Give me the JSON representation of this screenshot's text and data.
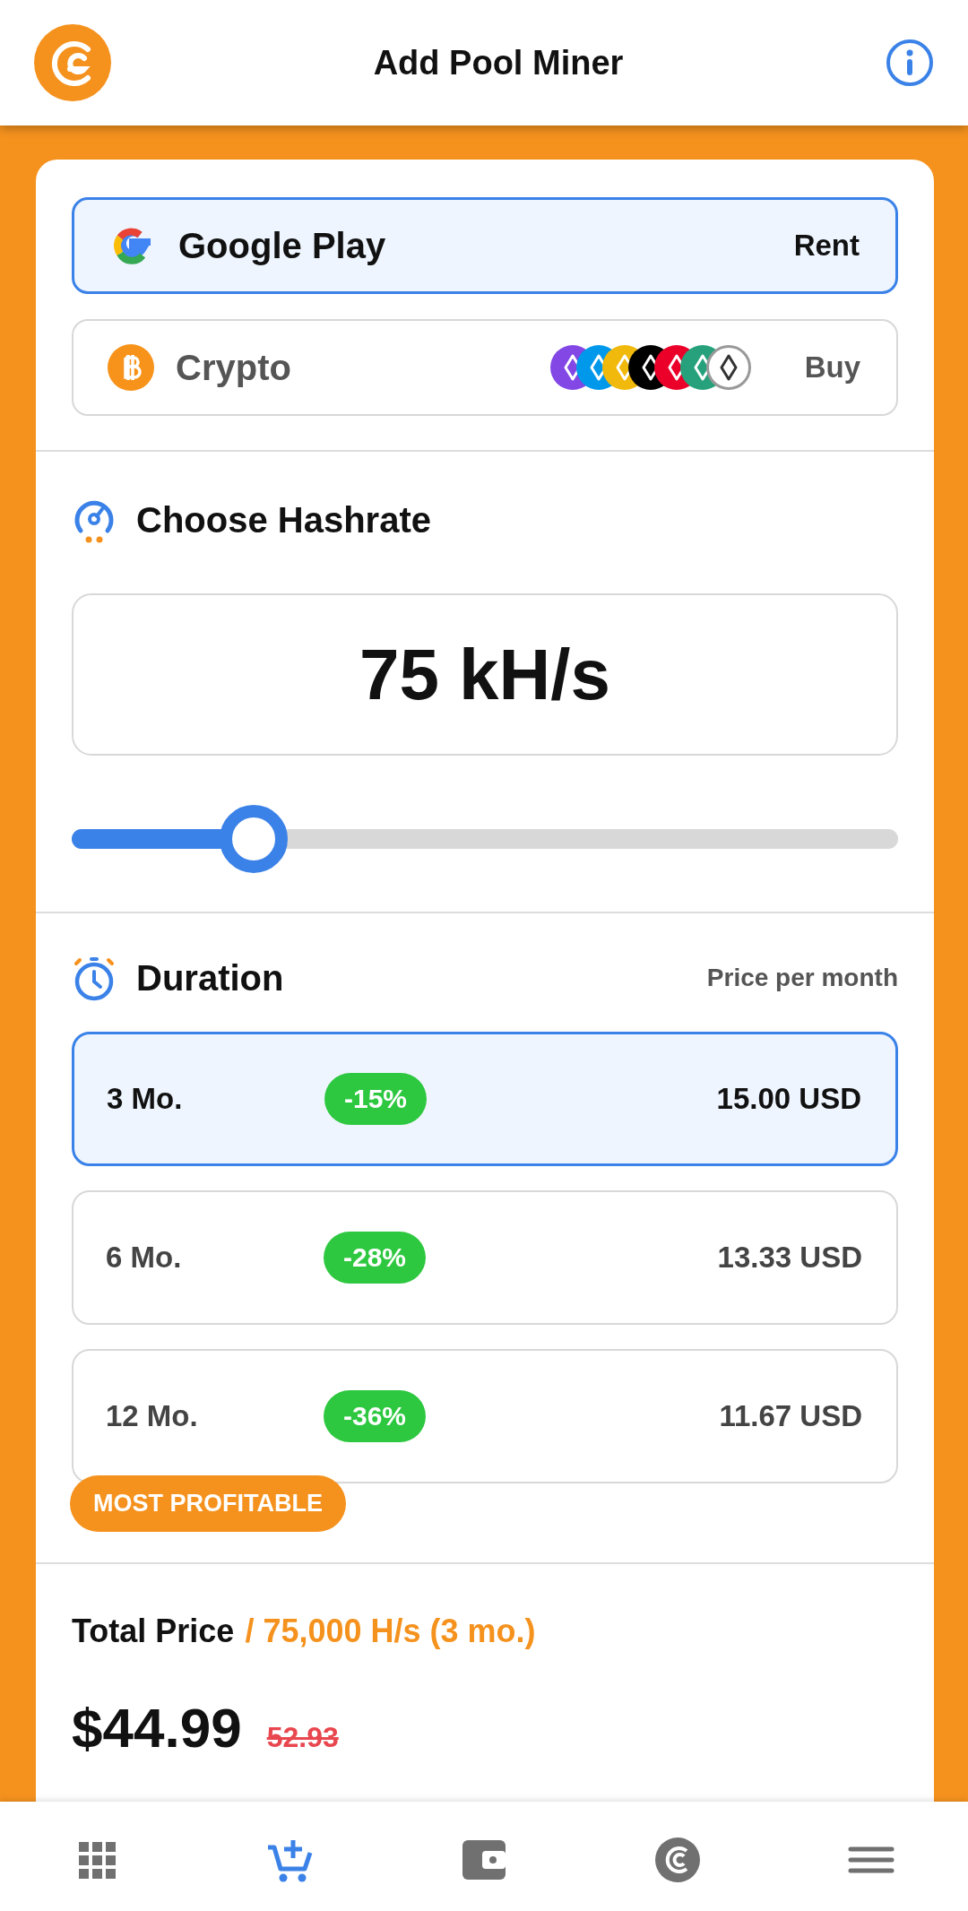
{
  "header": {
    "title": "Add Pool Miner"
  },
  "payment_methods": [
    {
      "kind": "google",
      "name": "Google Play",
      "action": "Rent",
      "selected": true
    },
    {
      "kind": "crypto",
      "name": "Crypto",
      "action": "Buy",
      "selected": false,
      "coins": [
        {
          "color": "#8247e5"
        },
        {
          "color": "#0098ea"
        },
        {
          "color": "#f0b90b"
        },
        {
          "color": "#000000"
        },
        {
          "color": "#eb0029"
        },
        {
          "color": "#26a17b"
        },
        {
          "color": "#ffffff"
        }
      ]
    }
  ],
  "hashrate": {
    "title": "Choose Hashrate",
    "value": "75 kH/s",
    "level": 0.22
  },
  "duration": {
    "title": "Duration",
    "note": "Price per month",
    "options": [
      {
        "label": "3 Mo.",
        "discount": "-15%",
        "price": "15.00 USD",
        "selected": true
      },
      {
        "label": "6 Mo.",
        "discount": "-28%",
        "price": "13.33 USD",
        "selected": false
      },
      {
        "label": "12 Mo.",
        "discount": "-36%",
        "price": "11.67 USD",
        "selected": false,
        "badge": "MOST PROFITABLE"
      }
    ]
  },
  "total": {
    "label": "Total Price",
    "detail": "/ 75,000 H/s (3 mo.)",
    "price": "$44.99",
    "old_price": "52.93"
  },
  "nav": [
    {
      "kind": "apps",
      "selected": false
    },
    {
      "kind": "cart",
      "selected": true
    },
    {
      "kind": "wallet",
      "selected": false
    },
    {
      "kind": "coin",
      "selected": false
    },
    {
      "kind": "menu",
      "selected": false
    }
  ]
}
